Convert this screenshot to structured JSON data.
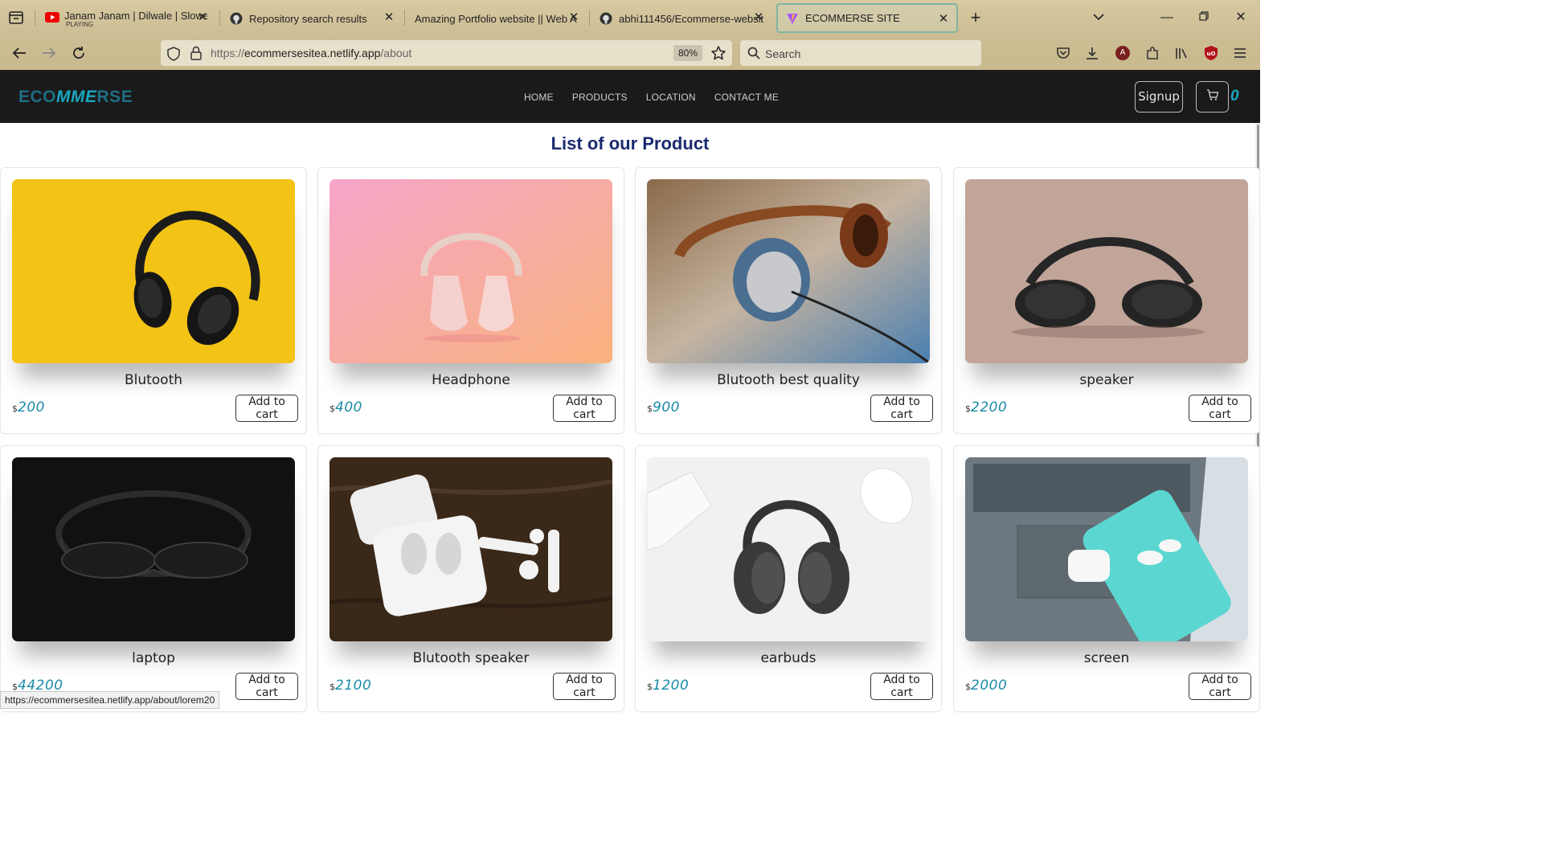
{
  "browser": {
    "tabs": [
      {
        "title": "Janam Janam | Dilwale | Slowed",
        "subtitle": "PLAYING",
        "icon": "youtube-icon"
      },
      {
        "title": "Repository search results",
        "icon": "github-icon"
      },
      {
        "title": "Amazing Portfolio website || Web A",
        "icon": "none"
      },
      {
        "title": "abhi111456/Ecommerse-website",
        "icon": "github-icon"
      },
      {
        "title": "ECOMMERSE SITE",
        "icon": "vite-icon"
      }
    ],
    "url_scheme": "https://",
    "url_host": "ecommersesitea.netlify.app",
    "url_path": "/about",
    "zoom": "80%",
    "search_placeholder": "Search",
    "account_initial": "A",
    "status_url": "https://ecommersesitea.netlify.app/about/lorem20"
  },
  "site": {
    "logo": {
      "part1": "ECO",
      "part2": "MME",
      "part3": "RSE"
    },
    "nav": [
      "HOME",
      "PRODUCTS",
      "LOCATION",
      "CONTACT ME"
    ],
    "signup_label": "Signup",
    "cart_count": "0",
    "page_title": "List of our Product",
    "currency": "$",
    "add_label": "Add to cart",
    "products": [
      {
        "name": "Blutooth",
        "price": "200",
        "image": "black-headphones-yellow-bg"
      },
      {
        "name": "Headphone",
        "price": "400",
        "image": "pink-headphones"
      },
      {
        "name": "Blutooth best quality",
        "price": "900",
        "image": "brown-leather-headphones"
      },
      {
        "name": "speaker",
        "price": "2200",
        "image": "black-headphones-beige-bg"
      },
      {
        "name": "laptop",
        "price": "44200",
        "image": "black-headphones-dark-bg"
      },
      {
        "name": "Blutooth speaker",
        "price": "2100",
        "image": "white-earbuds-wood"
      },
      {
        "name": "earbuds",
        "price": "1200",
        "image": "headphones-keyboard-mouse"
      },
      {
        "name": "screen",
        "price": "2000",
        "image": "airpods-phone-laptop"
      }
    ]
  },
  "colors": {
    "accent": "#1aa8c2",
    "header_bg": "#1a1a1a",
    "title": "#1a2a6e",
    "price": "#1a8aa8"
  }
}
